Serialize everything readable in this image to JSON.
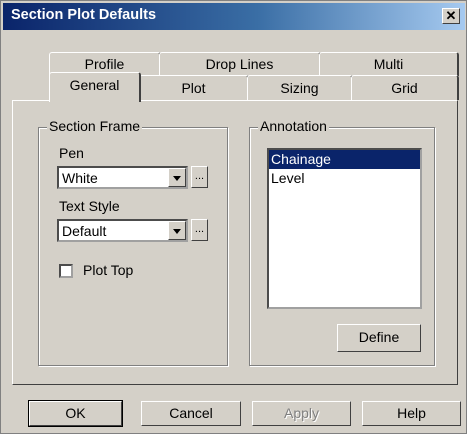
{
  "window": {
    "title": "Section Plot Defaults",
    "close_label": "✕"
  },
  "tabs": {
    "back_row": [
      "Profile",
      "Drop Lines",
      "Multi"
    ],
    "front_row": [
      "General",
      "Plot",
      "Sizing",
      "Grid"
    ],
    "selected": "General"
  },
  "section_frame": {
    "title": "Section Frame",
    "pen_label": "Pen",
    "pen_value": "White",
    "text_style_label": "Text Style",
    "text_style_value": "Default",
    "ellipsis": "...",
    "plot_top_label": "Plot Top",
    "plot_top_checked": false
  },
  "annotation": {
    "title": "Annotation",
    "items": [
      "Chainage",
      "Level"
    ],
    "selected_index": 0,
    "define_label": "Define"
  },
  "buttons": {
    "ok": "OK",
    "cancel": "Cancel",
    "apply": "Apply",
    "help": "Help"
  },
  "icons": {
    "close": "close-icon",
    "dropdown": "chevron-down-icon"
  }
}
